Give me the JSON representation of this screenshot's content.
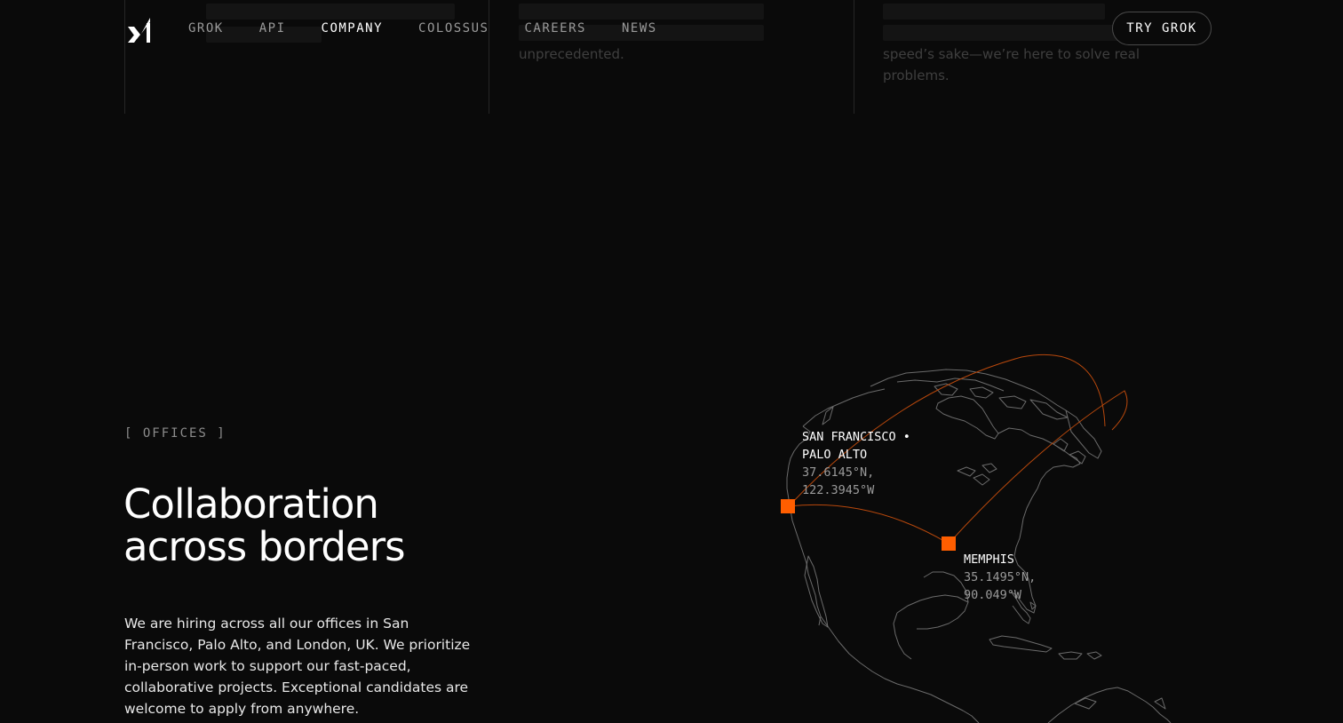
{
  "top_faded": {
    "col2_text": "unprecedented.",
    "col3_text_1": "speed’s sake—we’re here to solve real",
    "col3_text_2": "problems."
  },
  "nav": {
    "logo_icon": "xai-logo-icon",
    "links": [
      {
        "label": "GROK",
        "active": false
      },
      {
        "label": "API",
        "active": false
      },
      {
        "label": "COMPANY",
        "active": true
      },
      {
        "label": "COLOSSUS",
        "active": false
      },
      {
        "label": "CAREERS",
        "active": false
      },
      {
        "label": "NEWS",
        "active": false
      }
    ],
    "cta_label": "TRY GROK"
  },
  "offices": {
    "eyebrow": "[ OFFICES ]",
    "headline_1": "Collaboration",
    "headline_2": "across borders",
    "body": "We are hiring across all our offices in San Francisco, Palo Alto, and London, UK. We prioritize in-person work to support our fast-paced, collaborative projects. Exceptional candidates are welcome to apply from anywhere.",
    "locations": [
      {
        "city_1": "SAN FRANCISCO •",
        "city_2": "PALO ALTO",
        "lat": "37.6145°N,",
        "lon": "122.3945°W"
      },
      {
        "city_1": "MEMPHIS",
        "lat": "35.1495°N,",
        "lon": "90.049°W"
      }
    ]
  },
  "colors": {
    "background": "#0a0a0a",
    "accent": "#ff5e00",
    "arc": "#b8480c",
    "map_line": "#6b6b6b"
  }
}
